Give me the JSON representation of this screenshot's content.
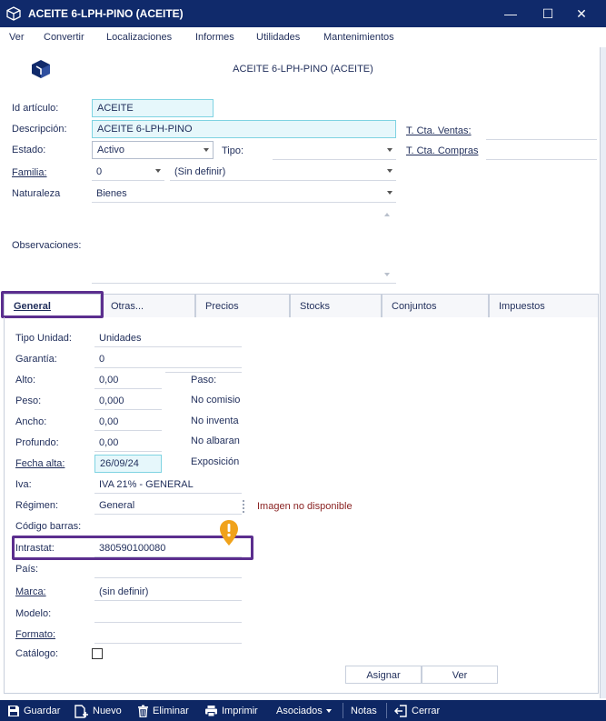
{
  "window": {
    "title": "ACEITE 6-LPH-PINO (ACEITE)",
    "controls": {
      "minimize": "—",
      "maximize": "☐",
      "close": "✕"
    }
  },
  "menu": [
    "Ver",
    "Convertir",
    "Localizaciones",
    "Informes",
    "Utilidades",
    "Mantenimientos"
  ],
  "header": {
    "title": "ACEITE 6-LPH-PINO (ACEITE)"
  },
  "form": {
    "id_label": "Id artículo:",
    "id_value": "ACEITE",
    "desc_label": "Descripción:",
    "desc_value": "ACEITE 6-LPH-PINO",
    "estado_label": "Estado:",
    "estado_value": "Activo",
    "tipo_label": "Tipo:",
    "tipo_value": "",
    "familia_label": "Familia:",
    "familia_code": "0",
    "familia_value": "(Sin definir)",
    "naturaleza_label": "Naturaleza",
    "naturaleza_value": "Bienes",
    "observaciones_label": "Observaciones:",
    "cta_ventas_label": "T. Cta. Ventas:",
    "cta_compras_label": "T. Cta. Compras"
  },
  "tabs": [
    {
      "label": "General",
      "active": true
    },
    {
      "label": "Otras...",
      "active": false
    },
    {
      "label": "Precios",
      "active": false
    },
    {
      "label": "Stocks",
      "active": false
    },
    {
      "label": "Conjuntos",
      "active": false
    },
    {
      "label": "Impuestos",
      "active": false
    }
  ],
  "general": {
    "tipo_unidad_label": "Tipo Unidad:",
    "tipo_unidad_value": "Unidades",
    "garantia_label": "Garantía:",
    "garantia_value": "0",
    "alto_label": "Alto:",
    "alto_value": "0,00",
    "peso_label": "Peso:",
    "peso_value": "0,000",
    "ancho_label": "Ancho:",
    "ancho_value": "0,00",
    "profundo_label": "Profundo:",
    "profundo_value": "0,00",
    "fecha_alta_label": "Fecha alta:",
    "fecha_alta_value": "26/09/24",
    "iva_label": "Iva:",
    "iva_value": "IVA 21% - GENERAL",
    "regimen_label": "Régimen:",
    "regimen_value": "General",
    "codigo_barras_label": "Código barras:",
    "intrastat_label": "Intrastat:",
    "intrastat_value": "380590100080",
    "pais_label": "País:",
    "marca_label": "Marca:",
    "marca_value": "(sin definir)",
    "modelo_label": "Modelo:",
    "formato_label": "Formato:",
    "catalogo_label": "Catálogo:",
    "catalogo_checked": false,
    "paso_label": "Paso:",
    "no_comision_label": "No comisio",
    "no_inventario_label": "No inventa",
    "no_albaran_label": "No albaran",
    "exposicion_label": "Exposición",
    "imagen_msg": "Imagen no disponible",
    "asignar_label": "Asignar",
    "ver_label": "Ver"
  },
  "toolbar": {
    "guardar": "Guardar",
    "nuevo": "Nuevo",
    "eliminar": "Eliminar",
    "imprimir": "Imprimir",
    "asociados": "Asociados",
    "notas": "Notas",
    "cerrar": "Cerrar"
  },
  "colors": {
    "titlebar": "#102a6b",
    "toolbar": "#0e2764",
    "highlight": "#5b2e8e",
    "warning": "#f0a21b",
    "boxed_field_bg": "#e6f7fb",
    "boxed_field_border": "#7fd3e2"
  },
  "icons": {
    "app": "cube-icon",
    "logo": "cube-logo-icon",
    "warning": "warning-pin-icon"
  }
}
